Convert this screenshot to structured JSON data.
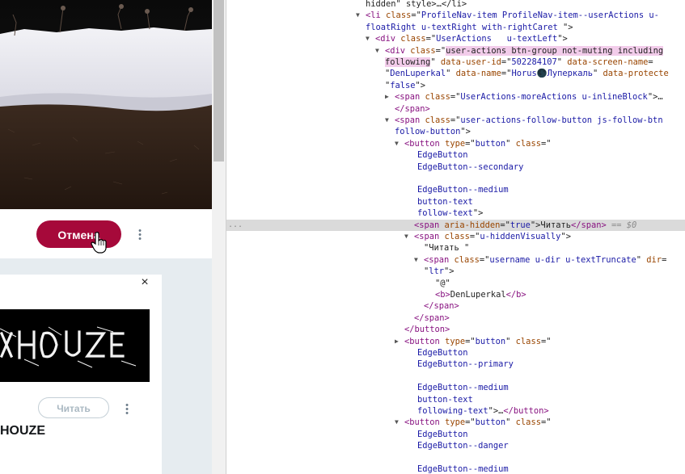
{
  "page": {
    "cancel_button": "Отмена",
    "follow_button": "Читать",
    "card_name": "HOUZE",
    "close_glyph": "×",
    "more_glyph": "•\n•\n•",
    "banner_text": "HOUZE",
    "accent": "#a6093a"
  },
  "devtools": {
    "gutter": "...",
    "lines": [
      {
        "indent": 0,
        "tri": "",
        "parts": [
          [
            "tx",
            "hidden\" style>…</li>"
          ]
        ]
      },
      {
        "indent": 0,
        "tri": "▼",
        "parts": [
          [
            "tag",
            "<li"
          ],
          [
            "tx",
            " "
          ],
          [
            "an",
            "class"
          ],
          [
            "tx",
            "=\""
          ],
          [
            "av",
            "ProfileNav-item ProfileNav-item--userActions u-"
          ]
        ]
      },
      {
        "indent": 0,
        "tri": "",
        "parts": [
          [
            "av",
            "floatRight u-textRight with-rightCaret "
          ],
          [
            "tx",
            "\">"
          ]
        ]
      },
      {
        "indent": 12,
        "tri": "▼",
        "parts": [
          [
            "tag",
            "<div"
          ],
          [
            "tx",
            " "
          ],
          [
            "an",
            "class"
          ],
          [
            "tx",
            "=\""
          ],
          [
            "av",
            "UserActions   u-textLeft"
          ],
          [
            "tx",
            "\">"
          ]
        ]
      },
      {
        "indent": 24,
        "tri": "▼",
        "parts": [
          [
            "tag",
            "<div"
          ],
          [
            "tx",
            " "
          ],
          [
            "an",
            "class"
          ],
          [
            "tx",
            "=\""
          ],
          [
            "hl",
            "user-actions btn-group not-muting including"
          ]
        ]
      },
      {
        "indent": 24,
        "tri": "",
        "parts": [
          [
            "hl",
            "following"
          ],
          [
            "tx",
            "\" "
          ],
          [
            "an",
            "data-user-id"
          ],
          [
            "tx",
            "=\""
          ],
          [
            "av",
            "502284107"
          ],
          [
            "tx",
            "\" "
          ],
          [
            "an",
            "data-screen-name"
          ],
          [
            "tx",
            "="
          ]
        ]
      },
      {
        "indent": 24,
        "tri": "",
        "parts": [
          [
            "tx",
            "\""
          ],
          [
            "av",
            "DenLuperkal"
          ],
          [
            "tx",
            "\" "
          ],
          [
            "an",
            "data-name"
          ],
          [
            "tx",
            "=\""
          ],
          [
            "av",
            "Horus🌑Луперкаль"
          ],
          [
            "tx",
            "\" "
          ],
          [
            "an",
            "data-protecte"
          ]
        ]
      },
      {
        "indent": 24,
        "tri": "",
        "parts": [
          [
            "tx",
            "\""
          ],
          [
            "av",
            "false"
          ],
          [
            "tx",
            "\">"
          ]
        ]
      },
      {
        "indent": 36,
        "tri": "▶",
        "parts": [
          [
            "tag",
            "<span"
          ],
          [
            "tx",
            " "
          ],
          [
            "an",
            "class"
          ],
          [
            "tx",
            "=\""
          ],
          [
            "av",
            "UserActions-moreActions u-inlineBlock"
          ],
          [
            "tx",
            "\">…"
          ]
        ]
      },
      {
        "indent": 36,
        "tri": "",
        "parts": [
          [
            "tag",
            "</span>"
          ]
        ]
      },
      {
        "indent": 36,
        "tri": "▼",
        "parts": [
          [
            "tag",
            "<span"
          ],
          [
            "tx",
            " "
          ],
          [
            "an",
            "class"
          ],
          [
            "tx",
            "=\""
          ],
          [
            "av",
            "user-actions-follow-button js-follow-btn"
          ]
        ]
      },
      {
        "indent": 36,
        "tri": "",
        "parts": [
          [
            "av",
            "follow-button"
          ],
          [
            "tx",
            "\">"
          ]
        ]
      },
      {
        "indent": 48,
        "tri": "▼",
        "parts": [
          [
            "tag",
            "<button"
          ],
          [
            "tx",
            " "
          ],
          [
            "an",
            "type"
          ],
          [
            "tx",
            "=\""
          ],
          [
            "av",
            "button"
          ],
          [
            "tx",
            "\" "
          ],
          [
            "an",
            "class"
          ],
          [
            "tx",
            "=\""
          ]
        ]
      },
      {
        "indent": 64,
        "tri": "",
        "parts": [
          [
            "av",
            "EdgeButton"
          ]
        ]
      },
      {
        "indent": 64,
        "tri": "",
        "parts": [
          [
            "av",
            "EdgeButton--secondary"
          ]
        ]
      },
      {
        "indent": 64,
        "tri": "",
        "parts": []
      },
      {
        "indent": 64,
        "tri": "",
        "parts": [
          [
            "av",
            "EdgeButton--medium"
          ]
        ]
      },
      {
        "indent": 64,
        "tri": "",
        "parts": [
          [
            "av",
            "button-text"
          ]
        ]
      },
      {
        "indent": 64,
        "tri": "",
        "parts": [
          [
            "av",
            "follow-text"
          ],
          [
            "tx",
            "\">"
          ]
        ]
      },
      {
        "indent": 60,
        "tri": "",
        "sel": true,
        "parts": [
          [
            "tag",
            "<span"
          ],
          [
            "tx",
            " "
          ],
          [
            "an",
            "aria-hidden"
          ],
          [
            "tx",
            "=\""
          ],
          [
            "av",
            "true"
          ],
          [
            "tx",
            "\">Читать"
          ],
          [
            "tag",
            "</span>"
          ],
          [
            "eq",
            " == $0"
          ]
        ]
      },
      {
        "indent": 60,
        "tri": "▼",
        "parts": [
          [
            "tag",
            "<span"
          ],
          [
            "tx",
            " "
          ],
          [
            "an",
            "class"
          ],
          [
            "tx",
            "=\""
          ],
          [
            "av",
            "u-hiddenVisually"
          ],
          [
            "tx",
            "\">"
          ]
        ]
      },
      {
        "indent": 72,
        "tri": "",
        "parts": [
          [
            "tx",
            "\"Читать \""
          ]
        ]
      },
      {
        "indent": 72,
        "tri": "▼",
        "parts": [
          [
            "tag",
            "<span"
          ],
          [
            "tx",
            " "
          ],
          [
            "an",
            "class"
          ],
          [
            "tx",
            "=\""
          ],
          [
            "av",
            "username u-dir u-textTruncate"
          ],
          [
            "tx",
            "\" "
          ],
          [
            "an",
            "dir"
          ],
          [
            "tx",
            "="
          ]
        ]
      },
      {
        "indent": 72,
        "tri": "",
        "parts": [
          [
            "tx",
            "\""
          ],
          [
            "av",
            "ltr"
          ],
          [
            "tx",
            "\">"
          ]
        ]
      },
      {
        "indent": 86,
        "tri": "",
        "parts": [
          [
            "tx",
            "\"@\""
          ]
        ]
      },
      {
        "indent": 86,
        "tri": "",
        "parts": [
          [
            "tag",
            "<b>"
          ],
          [
            "tx",
            "DenLuperkal"
          ],
          [
            "tag",
            "</b>"
          ]
        ]
      },
      {
        "indent": 72,
        "tri": "",
        "parts": [
          [
            "tag",
            "</span>"
          ]
        ]
      },
      {
        "indent": 60,
        "tri": "",
        "parts": [
          [
            "tag",
            "</span>"
          ]
        ]
      },
      {
        "indent": 48,
        "tri": "",
        "parts": [
          [
            "tag",
            "</button>"
          ]
        ]
      },
      {
        "indent": 48,
        "tri": "▶",
        "parts": [
          [
            "tag",
            "<button"
          ],
          [
            "tx",
            " "
          ],
          [
            "an",
            "type"
          ],
          [
            "tx",
            "=\""
          ],
          [
            "av",
            "button"
          ],
          [
            "tx",
            "\" "
          ],
          [
            "an",
            "class"
          ],
          [
            "tx",
            "=\""
          ]
        ]
      },
      {
        "indent": 64,
        "tri": "",
        "parts": [
          [
            "av",
            "EdgeButton"
          ]
        ]
      },
      {
        "indent": 64,
        "tri": "",
        "parts": [
          [
            "av",
            "EdgeButton--primary"
          ]
        ]
      },
      {
        "indent": 64,
        "tri": "",
        "parts": []
      },
      {
        "indent": 64,
        "tri": "",
        "parts": [
          [
            "av",
            "EdgeButton--medium"
          ]
        ]
      },
      {
        "indent": 64,
        "tri": "",
        "parts": [
          [
            "av",
            "button-text"
          ]
        ]
      },
      {
        "indent": 64,
        "tri": "",
        "parts": [
          [
            "av",
            "following-text"
          ],
          [
            "tx",
            "\">…"
          ],
          [
            "tag",
            "</button>"
          ]
        ]
      },
      {
        "indent": 48,
        "tri": "▼",
        "parts": [
          [
            "tag",
            "<button"
          ],
          [
            "tx",
            " "
          ],
          [
            "an",
            "type"
          ],
          [
            "tx",
            "=\""
          ],
          [
            "av",
            "button"
          ],
          [
            "tx",
            "\" "
          ],
          [
            "an",
            "class"
          ],
          [
            "tx",
            "=\""
          ]
        ]
      },
      {
        "indent": 64,
        "tri": "",
        "parts": [
          [
            "av",
            "EdgeButton"
          ]
        ]
      },
      {
        "indent": 64,
        "tri": "",
        "parts": [
          [
            "av",
            "EdgeButton--danger"
          ]
        ]
      },
      {
        "indent": 64,
        "tri": "",
        "parts": []
      },
      {
        "indent": 64,
        "tri": "",
        "parts": [
          [
            "av",
            "EdgeButton--medium"
          ]
        ]
      }
    ]
  }
}
